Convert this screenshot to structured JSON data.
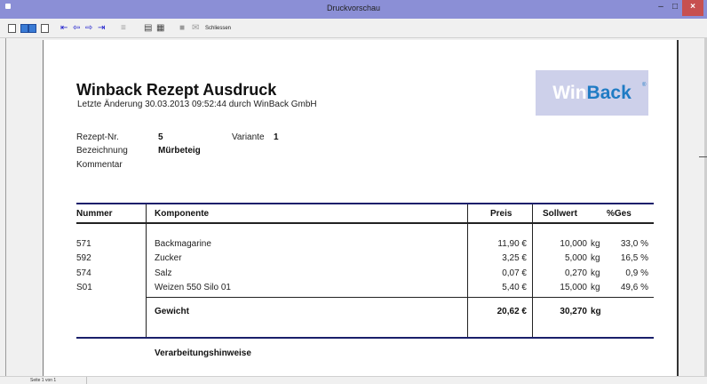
{
  "window": {
    "title": "Druckvorschau",
    "minimize": "–",
    "maximize": "□",
    "close": "×"
  },
  "toolbar": {
    "close_label": "Schliessen"
  },
  "document": {
    "title": "Winback Rezept Ausdruck",
    "subtitle": "Letzte Änderung 30.03.2013 09:52:44 durch WinBack GmbH",
    "logo": {
      "part1": "Win",
      "part2": "Back",
      "reg": "®"
    },
    "rezept_nr_label": "Rezept-Nr.",
    "rezept_nr_value": "5",
    "variante_label": "Variante",
    "variante_value": "1",
    "bezeichnung_label": "Bezeichnung",
    "bezeichnung_value": "Mürbeteig",
    "kommentar_label": "Kommentar"
  },
  "table": {
    "headers": {
      "nummer": "Nummer",
      "komponente": "Komponente",
      "preis": "Preis",
      "sollwert": "Sollwert",
      "ges": "%Ges"
    },
    "rows": [
      {
        "nummer": "571",
        "komponente": "Backmagarine",
        "preis": "11,90 €",
        "sollwert": "10,000",
        "unit": "kg",
        "ges": "33,0 %"
      },
      {
        "nummer": "592",
        "komponente": "Zucker",
        "preis": "3,25 €",
        "sollwert": "5,000",
        "unit": "kg",
        "ges": "16,5 %"
      },
      {
        "nummer": "574",
        "komponente": "Salz",
        "preis": "0,07 €",
        "sollwert": "0,270",
        "unit": "kg",
        "ges": "0,9 %"
      },
      {
        "nummer": "S01",
        "komponente": "Weizen 550 Silo 01",
        "preis": "5,40 €",
        "sollwert": "15,000",
        "unit": "kg",
        "ges": "49,6 %"
      }
    ],
    "total": {
      "label": "Gewicht",
      "preis": "20,62 €",
      "sollwert": "30,270",
      "unit": "kg"
    }
  },
  "footer_heading": "Verarbeitungshinweise",
  "status": {
    "page_text": "Seite 1 von 1"
  }
}
